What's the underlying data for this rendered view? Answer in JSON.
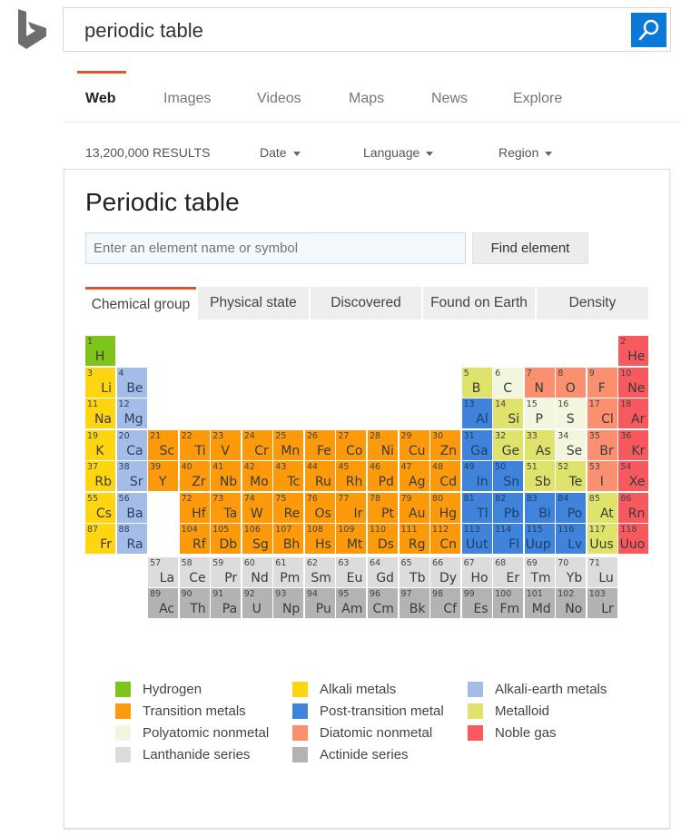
{
  "search": {
    "query": "periodic table",
    "button_icon": "search-icon"
  },
  "scopes": [
    {
      "label": "Web",
      "active": true
    },
    {
      "label": "Images",
      "active": false
    },
    {
      "label": "Videos",
      "active": false
    },
    {
      "label": "Maps",
      "active": false
    },
    {
      "label": "News",
      "active": false
    },
    {
      "label": "Explore",
      "active": false
    }
  ],
  "filters": {
    "results_count": "13,200,000 RESULTS",
    "date": "Date",
    "language": "Language",
    "region": "Region"
  },
  "card": {
    "title": "Periodic table",
    "input_placeholder": "Enter an element name or symbol",
    "input_value": "",
    "find_button": "Find element",
    "tabs": [
      {
        "label": "Chemical group",
        "active": true
      },
      {
        "label": "Physical state",
        "active": false
      },
      {
        "label": "Discovered",
        "active": false
      },
      {
        "label": "Found on Earth",
        "active": false
      },
      {
        "label": "Density",
        "active": false
      }
    ]
  },
  "groups": {
    "hydrogen": {
      "label": "Hydrogen",
      "color": "#7dc51b"
    },
    "alkali": {
      "label": "Alkali metals",
      "color": "#fdd611"
    },
    "alkaline": {
      "label": "Alkali-earth metals",
      "color": "#a3bde8"
    },
    "transition": {
      "label": "Transition metals",
      "color": "#fd9a0c"
    },
    "post": {
      "label": "Post-transition metal",
      "color": "#3f84da"
    },
    "metalloid": {
      "label": "Metalloid",
      "color": "#dfe36c"
    },
    "polyatomic": {
      "label": "Polyatomic nonmetal",
      "color": "#f2f6df"
    },
    "diatomic": {
      "label": "Diatomic nonmetal",
      "color": "#fb9070"
    },
    "noble": {
      "label": "Noble gas",
      "color": "#f7595f"
    },
    "lanthanide": {
      "label": "Lanthanide series",
      "color": "#dcdcdc"
    },
    "actinide": {
      "label": "Actinide series",
      "color": "#b3b3b3"
    }
  },
  "legend_order": [
    [
      "hydrogen",
      "alkali",
      "alkaline"
    ],
    [
      "transition",
      "post",
      "metalloid"
    ],
    [
      "polyatomic",
      "diatomic",
      "noble"
    ],
    [
      "lanthanide",
      "actinide"
    ]
  ],
  "elements": [
    [
      1,
      "H",
      1,
      1,
      "hydrogen"
    ],
    [
      2,
      "He",
      1,
      18,
      "noble"
    ],
    [
      3,
      "Li",
      2,
      1,
      "alkali"
    ],
    [
      4,
      "Be",
      2,
      2,
      "alkaline"
    ],
    [
      5,
      "B",
      2,
      13,
      "metalloid"
    ],
    [
      6,
      "C",
      2,
      14,
      "polyatomic"
    ],
    [
      7,
      "N",
      2,
      15,
      "diatomic"
    ],
    [
      8,
      "O",
      2,
      16,
      "diatomic"
    ],
    [
      9,
      "F",
      2,
      17,
      "diatomic"
    ],
    [
      10,
      "Ne",
      2,
      18,
      "noble"
    ],
    [
      11,
      "Na",
      3,
      1,
      "alkali"
    ],
    [
      12,
      "Mg",
      3,
      2,
      "alkaline"
    ],
    [
      13,
      "Al",
      3,
      13,
      "post"
    ],
    [
      14,
      "Si",
      3,
      14,
      "metalloid"
    ],
    [
      15,
      "P",
      3,
      15,
      "polyatomic"
    ],
    [
      16,
      "S",
      3,
      16,
      "polyatomic"
    ],
    [
      17,
      "Cl",
      3,
      17,
      "diatomic"
    ],
    [
      18,
      "Ar",
      3,
      18,
      "noble"
    ],
    [
      19,
      "K",
      4,
      1,
      "alkali"
    ],
    [
      20,
      "Ca",
      4,
      2,
      "alkaline"
    ],
    [
      21,
      "Sc",
      4,
      3,
      "transition"
    ],
    [
      22,
      "Ti",
      4,
      4,
      "transition"
    ],
    [
      23,
      "V",
      4,
      5,
      "transition"
    ],
    [
      24,
      "Cr",
      4,
      6,
      "transition"
    ],
    [
      25,
      "Mn",
      4,
      7,
      "transition"
    ],
    [
      26,
      "Fe",
      4,
      8,
      "transition"
    ],
    [
      27,
      "Co",
      4,
      9,
      "transition"
    ],
    [
      28,
      "Ni",
      4,
      10,
      "transition"
    ],
    [
      29,
      "Cu",
      4,
      11,
      "transition"
    ],
    [
      30,
      "Zn",
      4,
      12,
      "transition"
    ],
    [
      31,
      "Ga",
      4,
      13,
      "post"
    ],
    [
      32,
      "Ge",
      4,
      14,
      "metalloid"
    ],
    [
      33,
      "As",
      4,
      15,
      "metalloid"
    ],
    [
      34,
      "Se",
      4,
      16,
      "polyatomic"
    ],
    [
      35,
      "Br",
      4,
      17,
      "diatomic"
    ],
    [
      36,
      "Kr",
      4,
      18,
      "noble"
    ],
    [
      37,
      "Rb",
      5,
      1,
      "alkali"
    ],
    [
      38,
      "Sr",
      5,
      2,
      "alkaline"
    ],
    [
      39,
      "Y",
      5,
      3,
      "transition"
    ],
    [
      40,
      "Zr",
      5,
      4,
      "transition"
    ],
    [
      41,
      "Nb",
      5,
      5,
      "transition"
    ],
    [
      42,
      "Mo",
      5,
      6,
      "transition"
    ],
    [
      43,
      "Tc",
      5,
      7,
      "transition"
    ],
    [
      44,
      "Ru",
      5,
      8,
      "transition"
    ],
    [
      45,
      "Rh",
      5,
      9,
      "transition"
    ],
    [
      46,
      "Pd",
      5,
      10,
      "transition"
    ],
    [
      47,
      "Ag",
      5,
      11,
      "transition"
    ],
    [
      48,
      "Cd",
      5,
      12,
      "transition"
    ],
    [
      49,
      "In",
      5,
      13,
      "post"
    ],
    [
      50,
      "Sn",
      5,
      14,
      "post"
    ],
    [
      51,
      "Sb",
      5,
      15,
      "metalloid"
    ],
    [
      52,
      "Te",
      5,
      16,
      "metalloid"
    ],
    [
      53,
      "I",
      5,
      17,
      "diatomic"
    ],
    [
      54,
      "Xe",
      5,
      18,
      "noble"
    ],
    [
      55,
      "Cs",
      6,
      1,
      "alkali"
    ],
    [
      56,
      "Ba",
      6,
      2,
      "alkaline"
    ],
    [
      72,
      "Hf",
      6,
      4,
      "transition"
    ],
    [
      73,
      "Ta",
      6,
      5,
      "transition"
    ],
    [
      74,
      "W",
      6,
      6,
      "transition"
    ],
    [
      75,
      "Re",
      6,
      7,
      "transition"
    ],
    [
      76,
      "Os",
      6,
      8,
      "transition"
    ],
    [
      77,
      "Ir",
      6,
      9,
      "transition"
    ],
    [
      78,
      "Pt",
      6,
      10,
      "transition"
    ],
    [
      79,
      "Au",
      6,
      11,
      "transition"
    ],
    [
      80,
      "Hg",
      6,
      12,
      "transition"
    ],
    [
      81,
      "Tl",
      6,
      13,
      "post"
    ],
    [
      82,
      "Pb",
      6,
      14,
      "post"
    ],
    [
      83,
      "Bi",
      6,
      15,
      "post"
    ],
    [
      84,
      "Po",
      6,
      16,
      "post"
    ],
    [
      85,
      "At",
      6,
      17,
      "metalloid"
    ],
    [
      86,
      "Rn",
      6,
      18,
      "noble"
    ],
    [
      87,
      "Fr",
      7,
      1,
      "alkali"
    ],
    [
      88,
      "Ra",
      7,
      2,
      "alkaline"
    ],
    [
      104,
      "Rf",
      7,
      4,
      "transition"
    ],
    [
      105,
      "Db",
      7,
      5,
      "transition"
    ],
    [
      106,
      "Sg",
      7,
      6,
      "transition"
    ],
    [
      107,
      "Bh",
      7,
      7,
      "transition"
    ],
    [
      108,
      "Hs",
      7,
      8,
      "transition"
    ],
    [
      109,
      "Mt",
      7,
      9,
      "transition"
    ],
    [
      110,
      "Ds",
      7,
      10,
      "transition"
    ],
    [
      111,
      "Rg",
      7,
      11,
      "transition"
    ],
    [
      112,
      "Cn",
      7,
      12,
      "transition"
    ],
    [
      113,
      "Uut",
      7,
      13,
      "post"
    ],
    [
      114,
      "Fl",
      7,
      14,
      "post"
    ],
    [
      115,
      "Uup",
      7,
      15,
      "post"
    ],
    [
      116,
      "Lv",
      7,
      16,
      "post"
    ],
    [
      117,
      "Uus",
      7,
      17,
      "metalloid"
    ],
    [
      118,
      "Uuo",
      7,
      18,
      "noble"
    ],
    [
      57,
      "La",
      8,
      3,
      "lanthanide"
    ],
    [
      58,
      "Ce",
      8,
      4,
      "lanthanide"
    ],
    [
      59,
      "Pr",
      8,
      5,
      "lanthanide"
    ],
    [
      60,
      "Nd",
      8,
      6,
      "lanthanide"
    ],
    [
      61,
      "Pm",
      8,
      7,
      "lanthanide"
    ],
    [
      62,
      "Sm",
      8,
      8,
      "lanthanide"
    ],
    [
      63,
      "Eu",
      8,
      9,
      "lanthanide"
    ],
    [
      64,
      "Gd",
      8,
      10,
      "lanthanide"
    ],
    [
      65,
      "Tb",
      8,
      11,
      "lanthanide"
    ],
    [
      66,
      "Dy",
      8,
      12,
      "lanthanide"
    ],
    [
      67,
      "Ho",
      8,
      13,
      "lanthanide"
    ],
    [
      68,
      "Er",
      8,
      14,
      "lanthanide"
    ],
    [
      69,
      "Tm",
      8,
      15,
      "lanthanide"
    ],
    [
      70,
      "Yb",
      8,
      16,
      "lanthanide"
    ],
    [
      71,
      "Lu",
      8,
      17,
      "lanthanide"
    ],
    [
      89,
      "Ac",
      9,
      3,
      "actinide"
    ],
    [
      90,
      "Th",
      9,
      4,
      "actinide"
    ],
    [
      91,
      "Pa",
      9,
      5,
      "actinide"
    ],
    [
      92,
      "U",
      9,
      6,
      "actinide"
    ],
    [
      93,
      "Np",
      9,
      7,
      "actinide"
    ],
    [
      94,
      "Pu",
      9,
      8,
      "actinide"
    ],
    [
      95,
      "Am",
      9,
      9,
      "actinide"
    ],
    [
      96,
      "Cm",
      9,
      10,
      "actinide"
    ],
    [
      97,
      "Bk",
      9,
      11,
      "actinide"
    ],
    [
      98,
      "Cf",
      9,
      12,
      "actinide"
    ],
    [
      99,
      "Es",
      9,
      13,
      "actinide"
    ],
    [
      100,
      "Fm",
      9,
      14,
      "actinide"
    ],
    [
      101,
      "Md",
      9,
      15,
      "actinide"
    ],
    [
      102,
      "No",
      9,
      16,
      "actinide"
    ],
    [
      103,
      "Lr",
      9,
      17,
      "actinide"
    ]
  ]
}
